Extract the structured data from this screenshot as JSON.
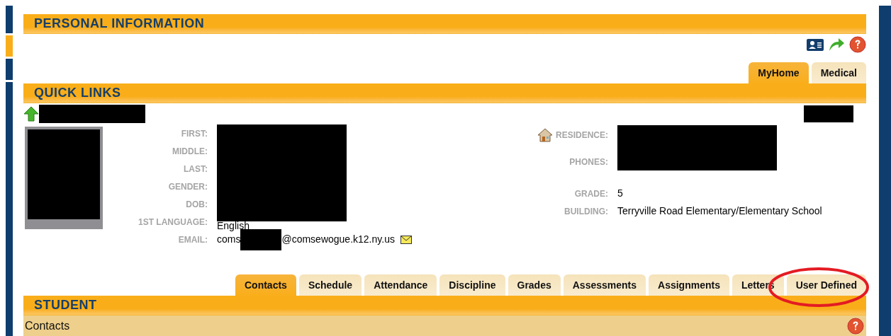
{
  "personal_information": {
    "title": "PERSONAL INFORMATION"
  },
  "top_tabs": [
    {
      "label": "MyHome",
      "selected": true
    },
    {
      "label": "Medical",
      "selected": false
    }
  ],
  "quick_links": {
    "title": "QUICK LINKS"
  },
  "left_fields": [
    {
      "label": "FIRST:",
      "kind": "redacted"
    },
    {
      "label": "MIDDLE:",
      "kind": "redacted"
    },
    {
      "label": "LAST:",
      "kind": "redacted"
    },
    {
      "label": "GENDER:",
      "kind": "redacted"
    },
    {
      "label": "DOB:",
      "kind": "redacted"
    },
    {
      "label": "1ST LANGUAGE:",
      "kind": "text",
      "value": "English"
    },
    {
      "label": "EMAIL:",
      "kind": "email",
      "value_start": "coms",
      "value_end": "@comsewogue.k12.ny.us"
    }
  ],
  "right_fields": [
    {
      "label": "RESIDENCE:",
      "kind": "redacted"
    },
    {
      "label": "PHONES:",
      "kind": "redacted"
    },
    {
      "label": "GRADE:",
      "kind": "text",
      "value": "5"
    },
    {
      "label": "BUILDING:",
      "kind": "text",
      "value": "Terryville Road Elementary/Elementary School"
    }
  ],
  "bottom_tabs": [
    {
      "label": "Contacts",
      "selected": true
    },
    {
      "label": "Schedule",
      "selected": false
    },
    {
      "label": "Attendance",
      "selected": false
    },
    {
      "label": "Discipline",
      "selected": false
    },
    {
      "label": "Grades",
      "selected": false
    },
    {
      "label": "Assessments",
      "selected": false
    },
    {
      "label": "Assignments",
      "selected": false
    },
    {
      "label": "Letters",
      "selected": false
    },
    {
      "label": "User Defined",
      "selected": false
    }
  ],
  "student": {
    "title": "STUDENT",
    "subsection": "Contacts"
  }
}
